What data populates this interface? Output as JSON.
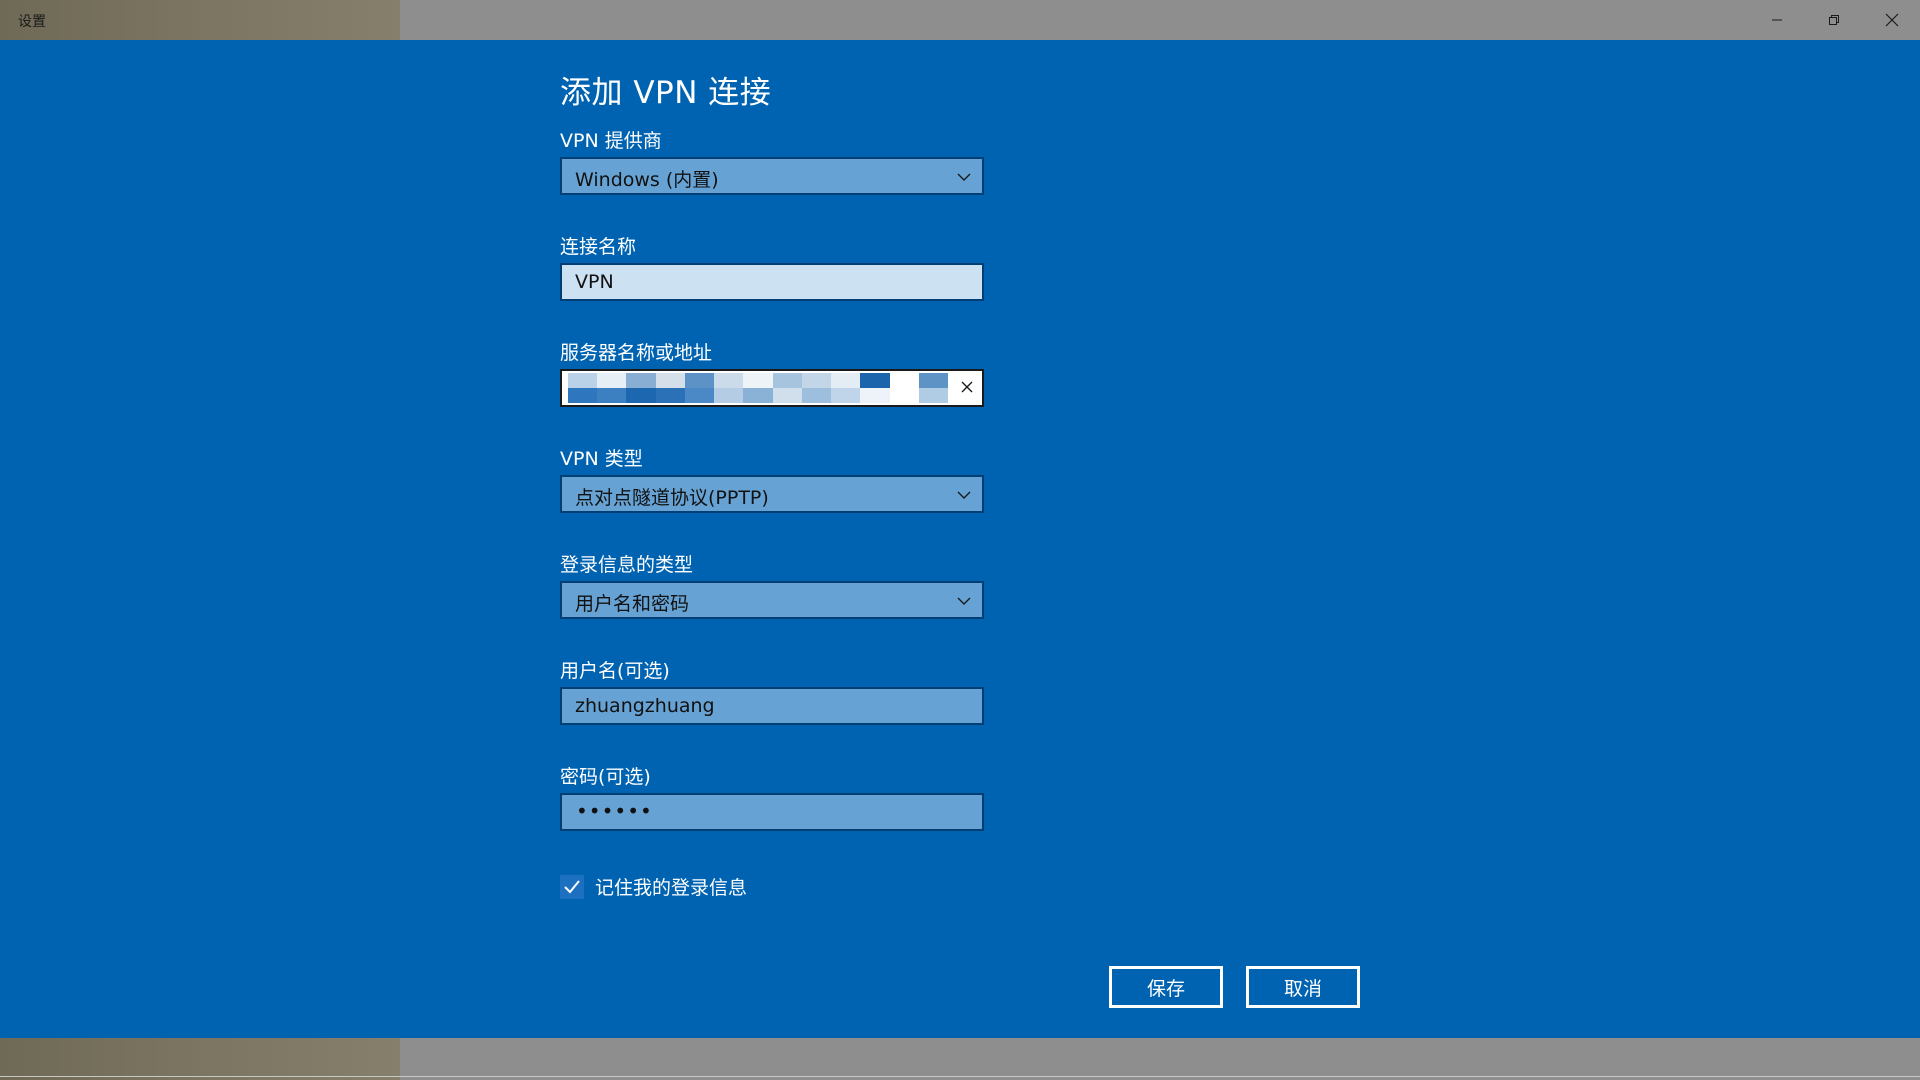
{
  "window": {
    "app_title": "设置",
    "controls": {
      "minimize_icon": "minimize-icon",
      "restore_icon": "restore-icon",
      "close_icon": "close-icon"
    }
  },
  "dialog": {
    "title": "添加 VPN 连接",
    "fields": {
      "provider": {
        "label": "VPN 提供商",
        "value": "Windows (内置)"
      },
      "connection_name": {
        "label": "连接名称",
        "value": "VPN"
      },
      "server": {
        "label": "服务器名称或地址",
        "value": ""
      },
      "vpn_type": {
        "label": "VPN 类型",
        "value": "点对点隧道协议(PPTP)"
      },
      "signin_type": {
        "label": "登录信息的类型",
        "value": "用户名和密码"
      },
      "username": {
        "label": "用户名(可选)",
        "value": "zhuangzhuang"
      },
      "password": {
        "label": "密码(可选)",
        "value": "••••••"
      }
    },
    "remember": {
      "label": "记住我的登录信息",
      "checked": true
    },
    "buttons": {
      "save": "保存",
      "cancel": "取消"
    }
  },
  "colors": {
    "dialog_bg": "#0063b1",
    "field_bg": "#66a3d4",
    "field_focus_bg": "#cce1f2",
    "field_border": "#003e73",
    "titlebar_bg": "#8e8e8e"
  }
}
